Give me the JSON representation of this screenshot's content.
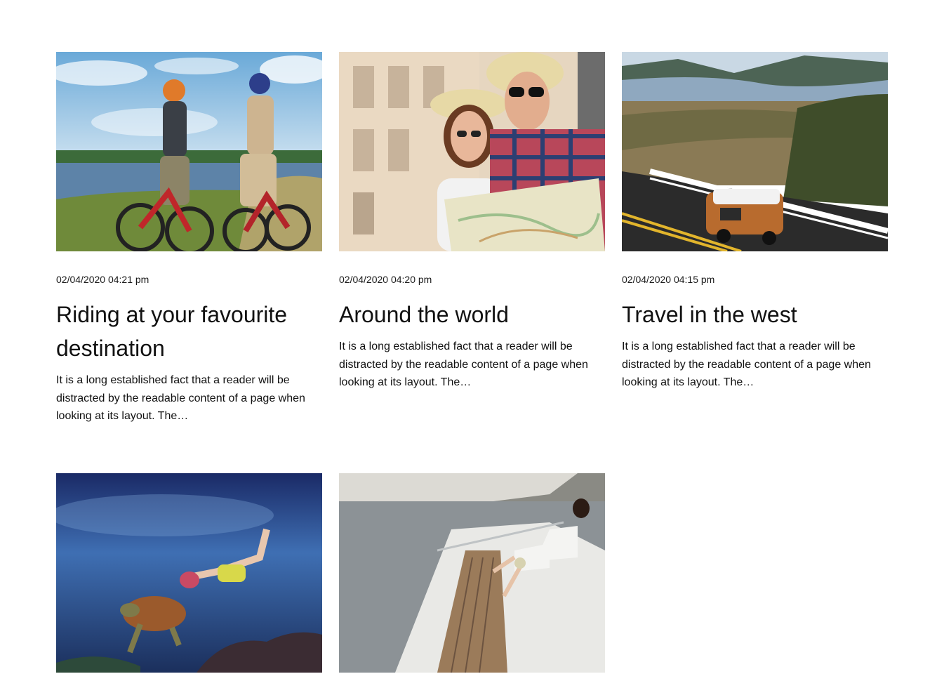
{
  "posts": [
    {
      "date": "02/04/2020 04:21 pm",
      "title": "Riding at your favourite destination",
      "excerpt": "It is a long established fact that a reader will be distracted by the readable content of a page when looking at its layout. The…"
    },
    {
      "date": "02/04/2020 04:20 pm",
      "title": "Around the world",
      "excerpt": "It is a long established fact that a reader will be distracted by the readable content of a page when looking at its layout. The…"
    },
    {
      "date": "02/04/2020 04:15 pm",
      "title": "Travel in the west",
      "excerpt": "It is a long established fact that a reader will be distracted by the readable content of a page when looking at its layout. The…"
    },
    {
      "date": "",
      "title": "",
      "excerpt": ""
    },
    {
      "date": "",
      "title": "",
      "excerpt": ""
    }
  ],
  "colors": {
    "text": "#111111",
    "background": "#ffffff"
  }
}
